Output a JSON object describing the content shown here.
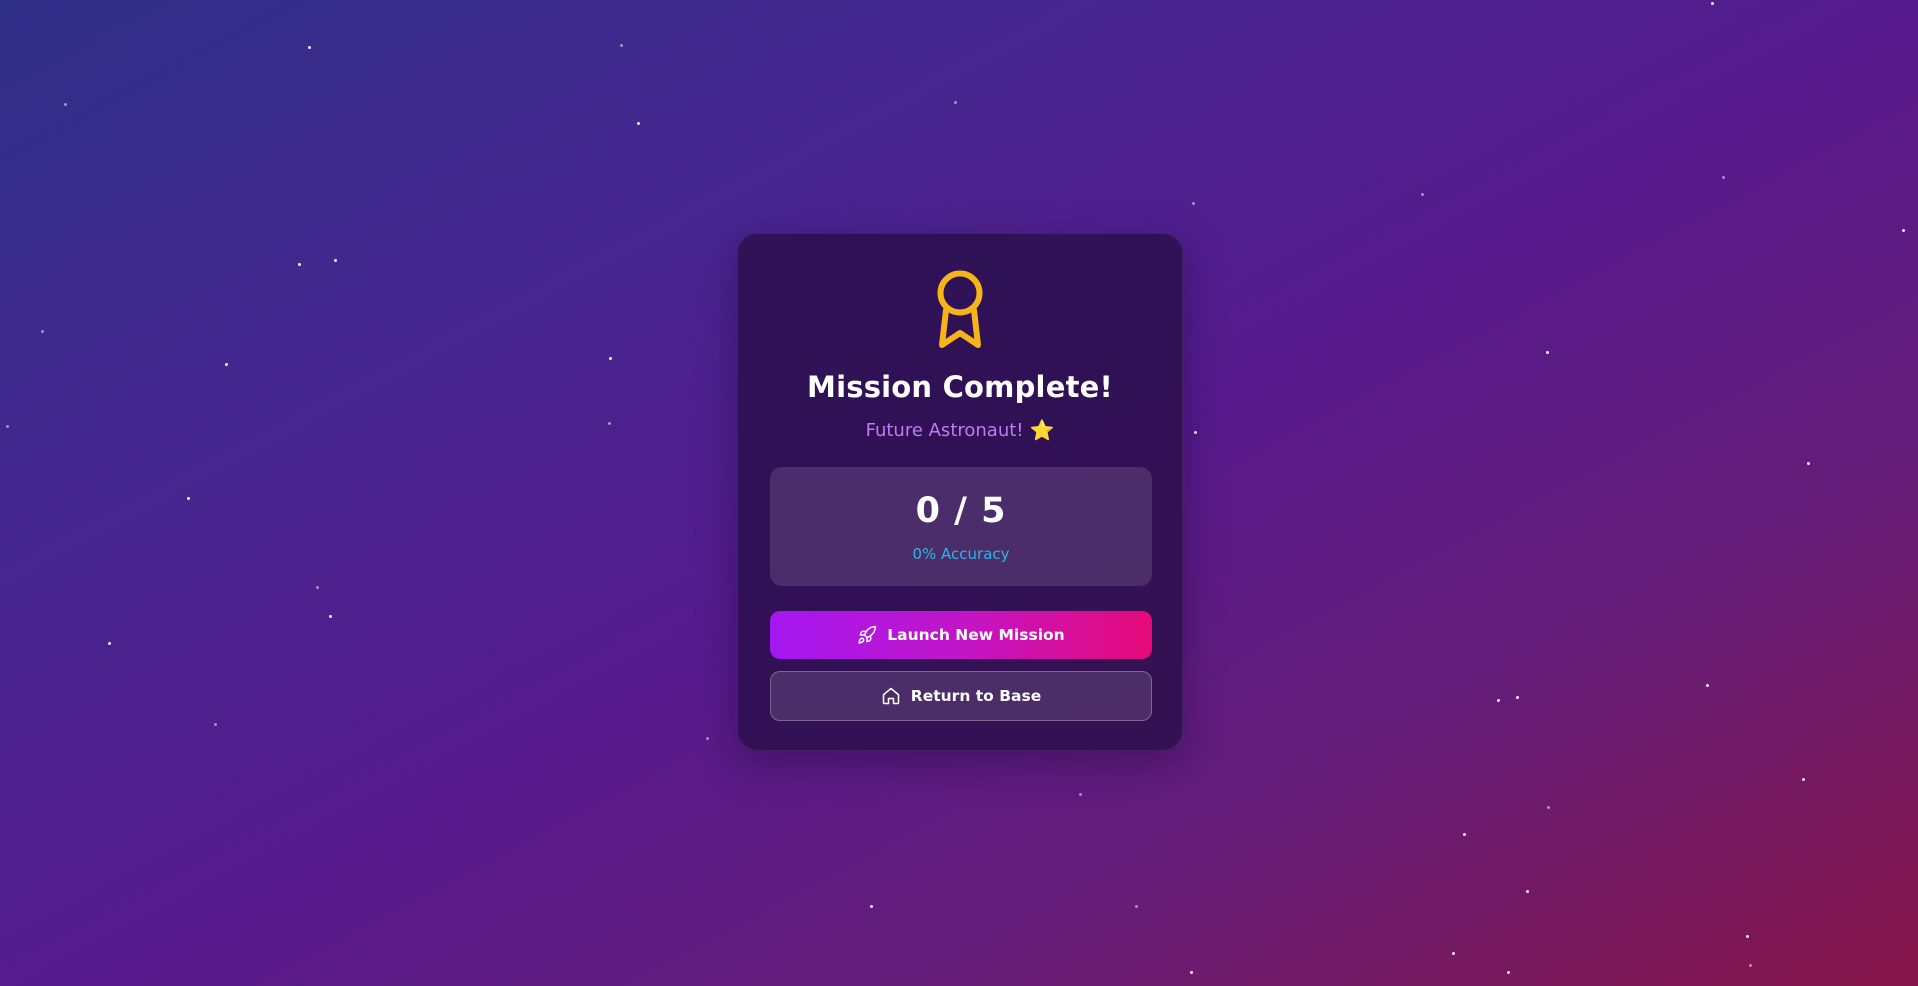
{
  "result_card": {
    "title": "Mission Complete!",
    "rank": "Future Astronaut!",
    "rank_emoji": "⭐",
    "score": "0 / 5",
    "accuracy": "0% Accuracy",
    "medal_icon": "award-icon"
  },
  "actions": {
    "launch_label": "Launch New Mission",
    "launch_icon": "rocket-icon",
    "return_label": "Return to Base",
    "return_icon": "home-icon"
  },
  "colors": {
    "accent_gold": "#f5b41a",
    "subtitle_purple": "#c27af2",
    "accuracy_cyan": "#2bb8e6",
    "launch_gradient_start": "#a417f2",
    "launch_gradient_end": "#e60a78"
  }
}
